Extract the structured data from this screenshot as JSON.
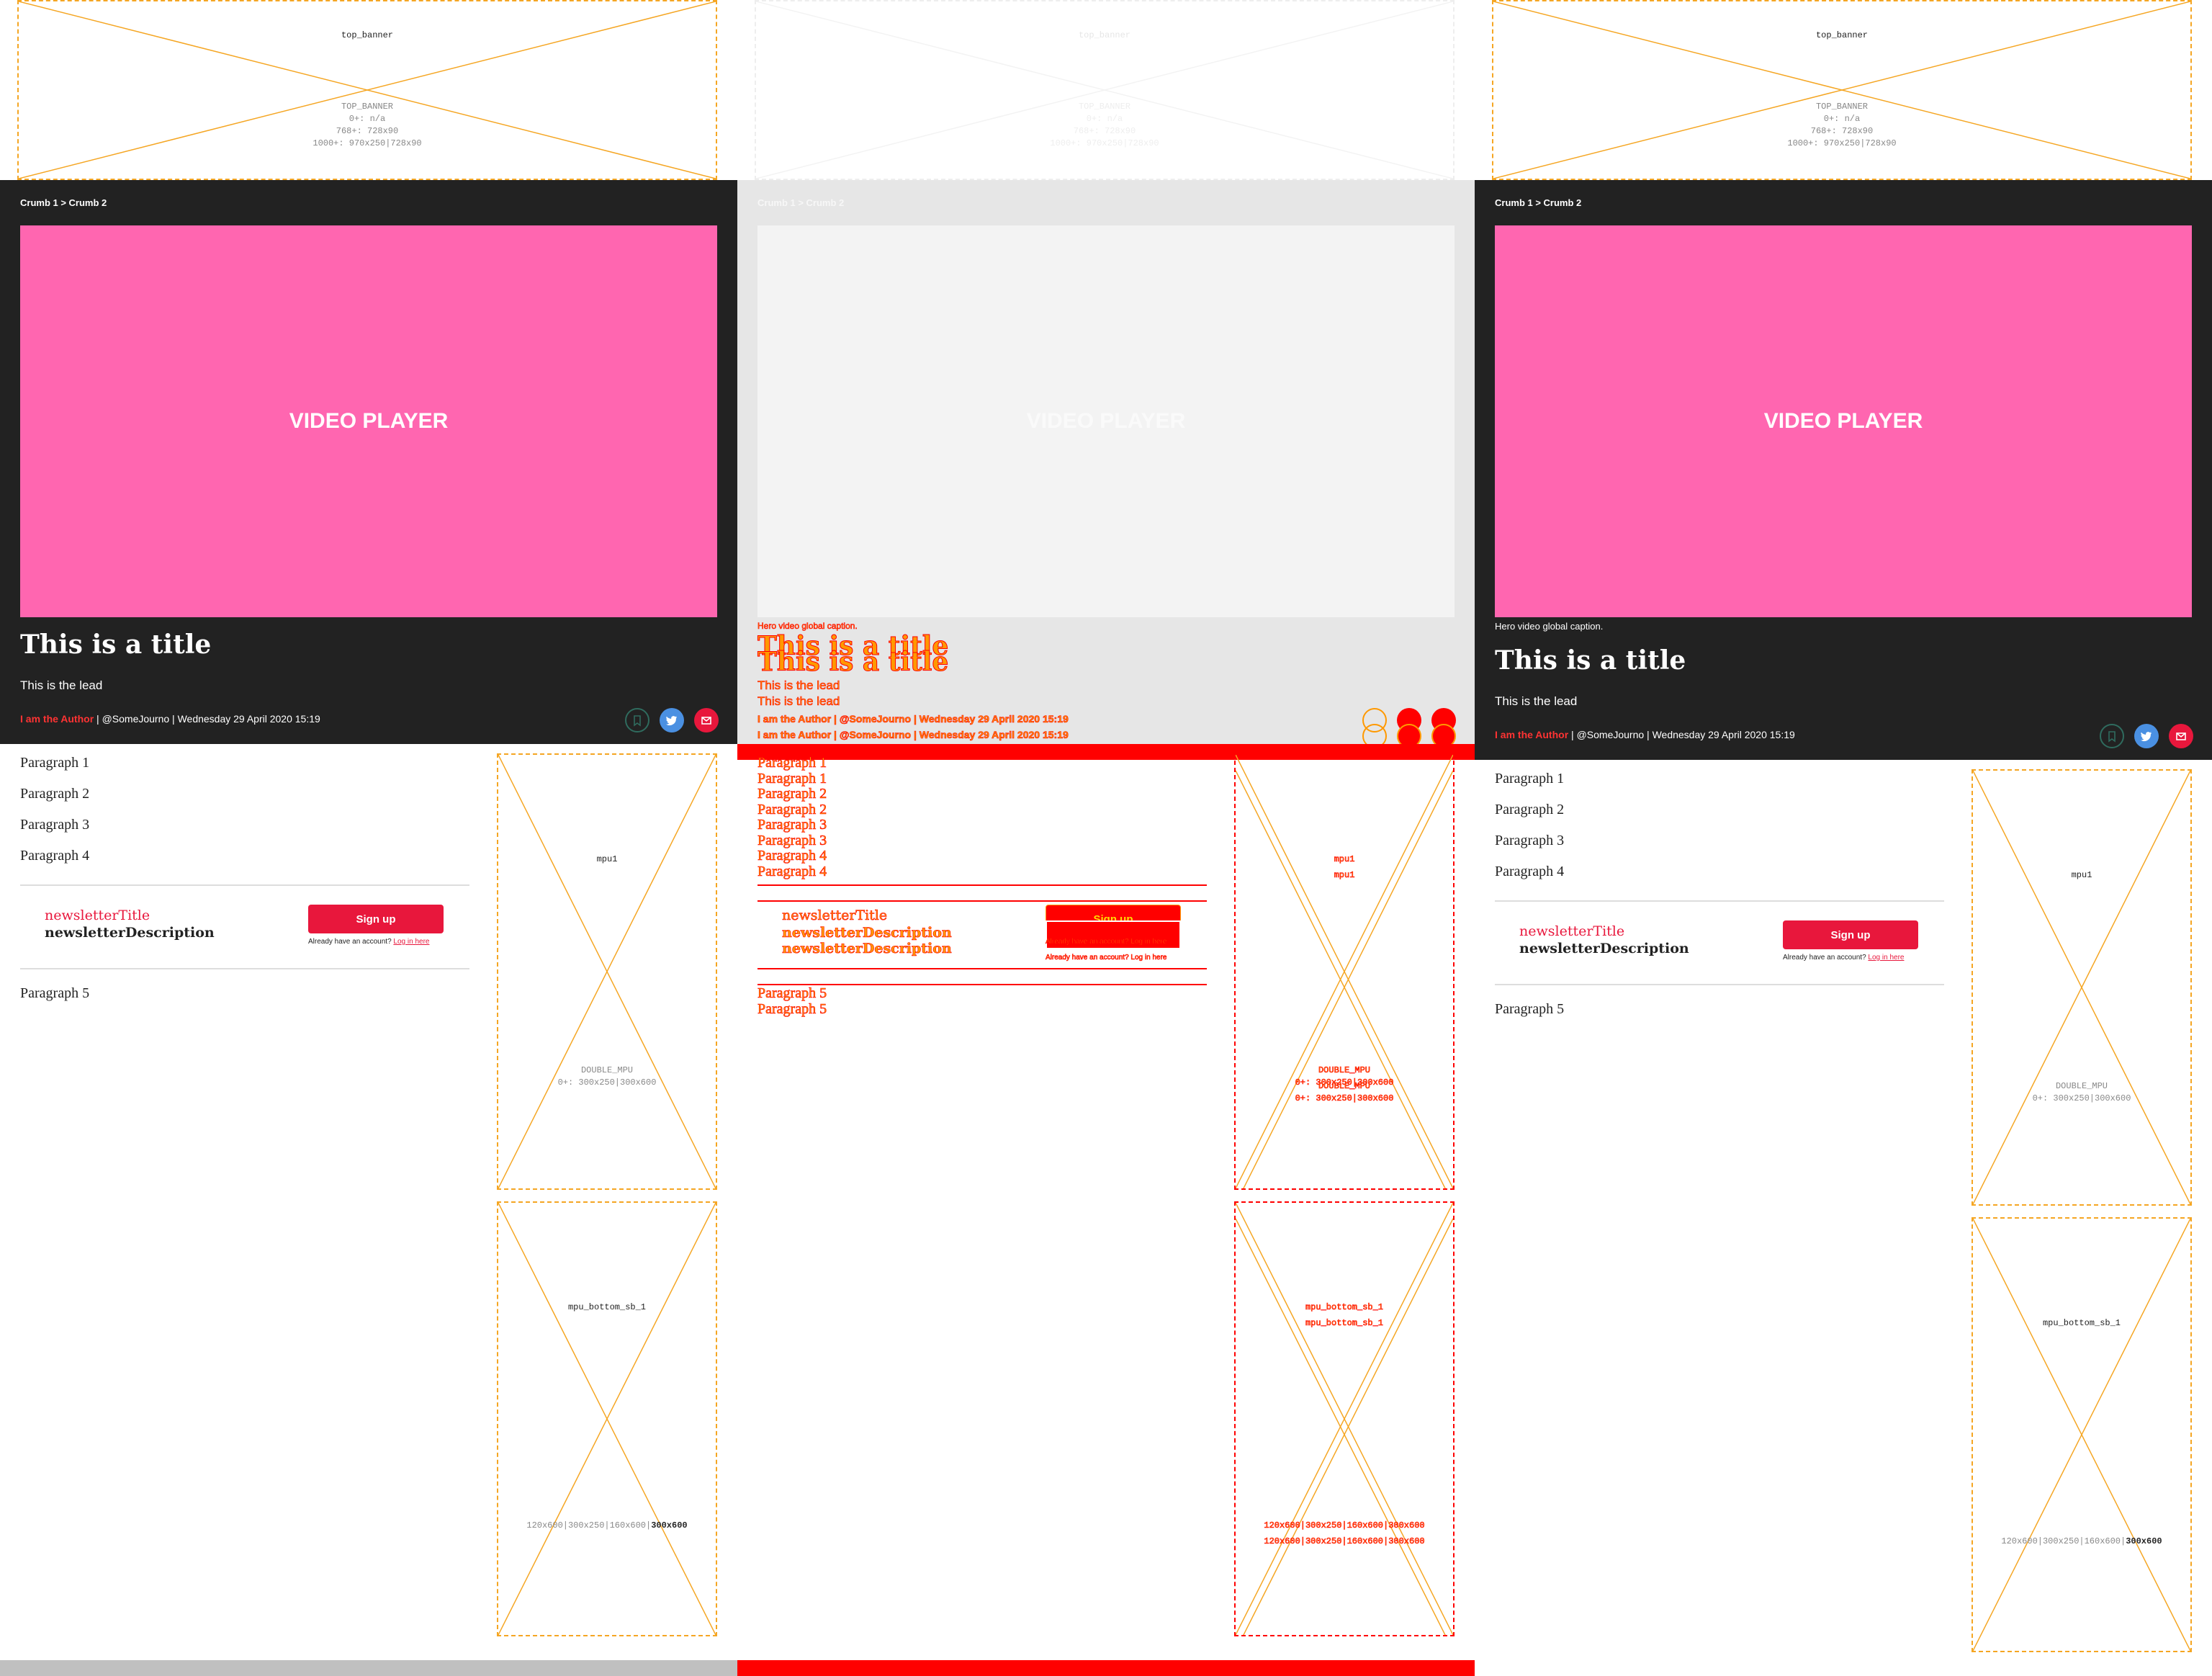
{
  "ad_slots": {
    "top_banner": {
      "name": "top_banner",
      "spec": [
        "TOP_BANNER",
        "0+: n/a",
        "768+: 728x90",
        "1000+: 970x250|728x90"
      ]
    },
    "mpu1": {
      "name": "mpu1",
      "spec": [
        "DOUBLE_MPU",
        "0+: 300x250|300x600"
      ]
    },
    "mpu_bottom": {
      "name": "mpu_bottom_sb_1",
      "spec": "120x600|300x250|160x600|",
      "spec_bold": "300x600"
    }
  },
  "header": {
    "breadcrumb": "Crumb 1 > Crumb 2",
    "video_label": "VIDEO PLAYER",
    "caption": "Hero video global caption.",
    "title": "This is a title",
    "lead": "This is the lead",
    "author": "I am the Author",
    "byline_rest": "| @SomeJourno | Wednesday 29 April 2020 15:19"
  },
  "share_icons": [
    "bookmark-icon",
    "twitter-icon",
    "email-icon"
  ],
  "body": {
    "paragraphs": [
      "Paragraph 1",
      "Paragraph 2",
      "Paragraph 3",
      "Paragraph 4"
    ],
    "paragraph_after": "Paragraph 5"
  },
  "newsletter": {
    "title": "newsletterTitle",
    "description": "newsletterDescription",
    "button": "Sign up",
    "account_text": "Already have an account?",
    "login_link": "Log in here"
  },
  "colors": {
    "header_bg": "#222222",
    "video_bg": "#ff66b0",
    "accent_red": "#e8173c",
    "ad_outline": "#f5a623",
    "twitter": "#4a90e2",
    "debug_red": "#ff0000",
    "footer_grey": "#c0c0c0"
  }
}
